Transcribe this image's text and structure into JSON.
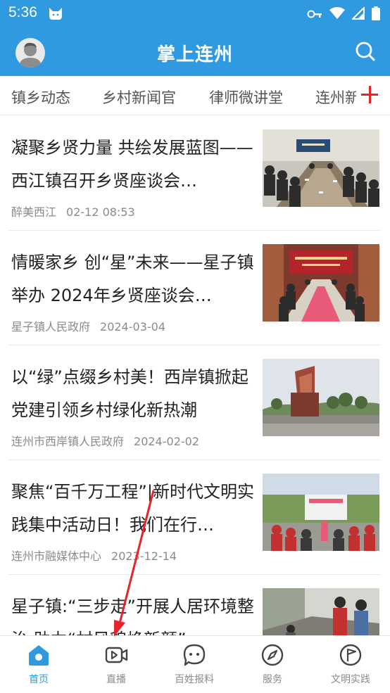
{
  "status": {
    "time": "5:36"
  },
  "app": {
    "title": "掌上连州"
  },
  "tabs": [
    {
      "label": "镇乡动态"
    },
    {
      "label": "乡村新闻官"
    },
    {
      "label": "律师微讲堂"
    },
    {
      "label": "连州新"
    }
  ],
  "articles": [
    {
      "title": "凝聚乡贤力量 共绘发展蓝图——西江镇召开乡贤座谈会…",
      "source": "醉美西江",
      "time": "02-12 08:53"
    },
    {
      "title": "情暖家乡 创“星”未来——星子镇举办 2024年乡贤座谈会…",
      "source": "星子镇人民政府",
      "time": "2024-03-04"
    },
    {
      "title": "以“绿”点缀乡村美！西岸镇掀起党建引领乡村绿化新热潮",
      "source": "连州市西岸镇人民政府",
      "time": "2024-02-02"
    },
    {
      "title": "聚焦“百千万工程”|新时代文明实践集中活动日！我们在行…",
      "source": "连州市融媒体中心",
      "time": "2023-12-14"
    },
    {
      "title": "星子镇:“三步走”开展人居环境整治 助力“村风貌焕新颜”",
      "source": "",
      "time": ""
    }
  ],
  "nav": [
    {
      "label": "首页",
      "icon": "home-icon",
      "active": true
    },
    {
      "label": "直播",
      "icon": "live-video-icon",
      "active": false
    },
    {
      "label": "百姓报料",
      "icon": "chat-bubble-icon",
      "active": false
    },
    {
      "label": "服务",
      "icon": "compass-icon",
      "active": false
    },
    {
      "label": "文明实践",
      "icon": "flag-badge-icon",
      "active": false
    }
  ],
  "colors": {
    "primary": "#2f9ae0",
    "accent": "#e8232a",
    "arrow": "#e8232a"
  }
}
